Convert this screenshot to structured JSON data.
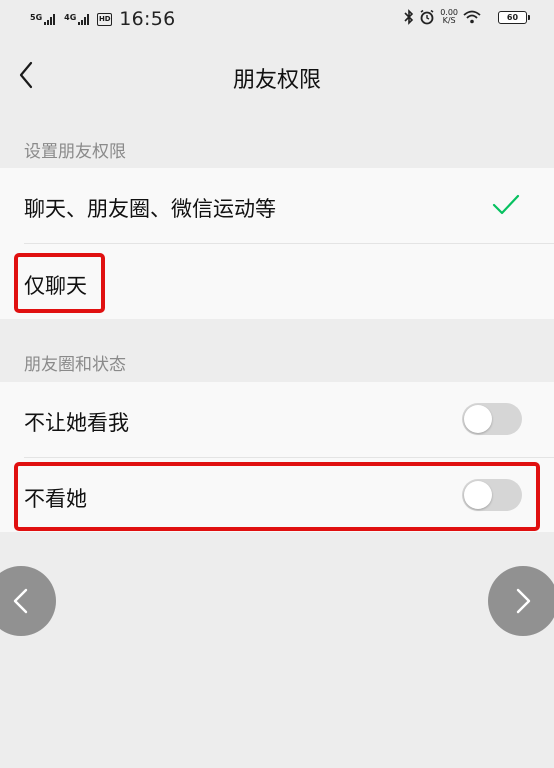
{
  "status_bar": {
    "sim1_label": "5G",
    "sim2_label": "4G",
    "sim_icon_label": "HD",
    "time": "16:56",
    "speed_value": "0.00",
    "speed_unit": "K/S",
    "battery_level": "60"
  },
  "nav": {
    "title": "朋友权限",
    "back_icon": "chevron-left-icon"
  },
  "permissions": {
    "section_label": "设置朋友权限",
    "options": [
      {
        "label": "聊天、朋友圈、微信运动等",
        "selected": true
      },
      {
        "label": "仅聊天",
        "selected": false
      }
    ]
  },
  "moments": {
    "section_label": "朋友圈和状态",
    "toggles": [
      {
        "label": "不让她看我",
        "on": false
      },
      {
        "label": "不看她",
        "on": false
      }
    ]
  },
  "colors": {
    "check": "#07c160",
    "highlight": "#e01010",
    "switch_off": "#d6d6d6"
  },
  "overlay": {
    "prev_icon": "chevron-left-icon",
    "next_icon": "chevron-right-icon"
  }
}
